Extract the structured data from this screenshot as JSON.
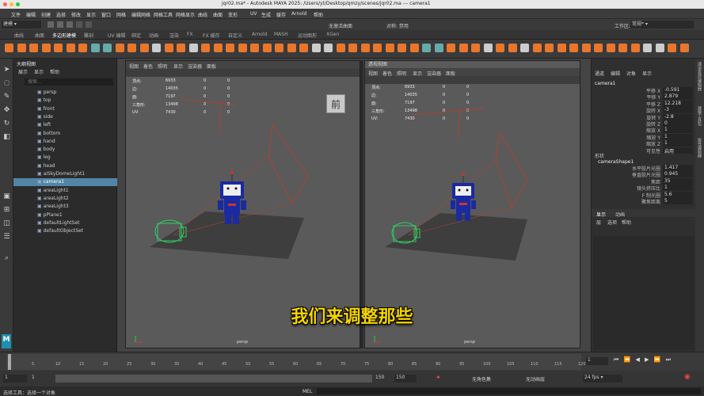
{
  "window": {
    "title": "jqr02.ma* - Autodesk MAYA 2025: /Users/yt/Desktop/qmzy/scenes/jqr02.ma  ---  camera1"
  },
  "menubar": {
    "items": [
      "文件",
      "编辑",
      "创建",
      "选择",
      "修改",
      "显示",
      "窗口",
      "网格",
      "编辑网格",
      "网格工具",
      "网格显示",
      "曲线",
      "曲面",
      "变形",
      "UV",
      "生成",
      "缓存",
      "Arnold",
      "帮助"
    ]
  },
  "statusline": {
    "mode": "建模",
    "symmetry": "对称: 禁用",
    "live": "无激活曲面",
    "workspace_label": "工作区:",
    "workspace": "常规*"
  },
  "shelf_tabs": [
    "曲线",
    "曲面",
    "多边形建模",
    "雕刻",
    "UV 编辑",
    "绑定",
    "动画",
    "渲染",
    "FX",
    "FX 缓存",
    "自定义",
    "Arnold",
    "MASH",
    "运动图形",
    "XGen"
  ],
  "shelf_active": "多边形建模",
  "outliner": {
    "title": "大纲视图",
    "menus": [
      "展示",
      "显示",
      "帮助"
    ],
    "search_placeholder": "搜索...",
    "items": [
      "persp",
      "top",
      "front",
      "side",
      "left",
      "bottom",
      "hand",
      "body",
      "leg",
      "head",
      "aiSkyDomeLight1",
      "camera1",
      "areaLight1",
      "areaLight2",
      "areaLight3",
      "pPlane1",
      "defaultLightSet",
      "defaultObjectSet"
    ],
    "selected": "camera1"
  },
  "viewport_left": {
    "menus": [
      "视图",
      "着色",
      "照明",
      "显示",
      "渲染器",
      "面板"
    ],
    "hud": [
      [
        "顶点:",
        "6933",
        "0",
        "0"
      ],
      [
        "边:",
        "14035",
        "0",
        "0"
      ],
      [
        "面:",
        "7197",
        "0",
        "0"
      ],
      [
        "三角形:",
        "13498",
        "0",
        "0"
      ],
      [
        "UV:",
        "7430",
        "0",
        "0"
      ]
    ],
    "camera_label": "persp",
    "viewcube": "前"
  },
  "viewport_right": {
    "title": "透视视图",
    "menus": [
      "视图",
      "着色",
      "照明",
      "显示",
      "渲染器",
      "面板"
    ],
    "hud": [
      [
        "顶点:",
        "6933",
        "0",
        "0"
      ],
      [
        "边:",
        "14035",
        "0",
        "0"
      ],
      [
        "面:",
        "7197",
        "0",
        "0"
      ],
      [
        "三角形:",
        "13498",
        "0",
        "0"
      ],
      [
        "UV:",
        "7430",
        "0",
        "0"
      ]
    ],
    "camera_label": "persp"
  },
  "channel_box": {
    "menus": [
      "通道",
      "编辑",
      "对象",
      "显示"
    ],
    "object": "camera1",
    "channels": [
      [
        "平移 X",
        "-0.591"
      ],
      [
        "平移 Y",
        "2.879"
      ],
      [
        "平移 Z",
        "12.218"
      ],
      [
        "旋转 X",
        "-3"
      ],
      [
        "旋转 Y",
        "-2.8"
      ],
      [
        "旋转 Z",
        "0"
      ],
      [
        "缩放 X",
        "1"
      ],
      [
        "缩放 Y",
        "1"
      ],
      [
        "缩放 Z",
        "1"
      ],
      [
        "可见性",
        "启用"
      ]
    ],
    "shapes_label": "形状",
    "shape": "cameraShape1",
    "shape_channels": [
      [
        "水平胶片光圈",
        "1.417"
      ],
      [
        "垂直胶片光圈",
        "0.945"
      ],
      [
        "焦距",
        "35"
      ],
      [
        "镜头挤压比",
        "1"
      ],
      [
        "F 制光圈",
        "5.6"
      ],
      [
        "聚焦距离",
        "5"
      ]
    ],
    "layer_tabs": [
      "显示",
      "动画"
    ],
    "layer_menus": [
      "层",
      "选项",
      "帮助"
    ]
  },
  "side_tabs": [
    "通道盒/层编辑器",
    "建模工具包",
    "属性编辑器"
  ],
  "timeline": {
    "ticks": [
      "1",
      "5",
      "10",
      "15",
      "20",
      "25",
      "30",
      "35",
      "40",
      "45",
      "50",
      "55",
      "60",
      "65",
      "70",
      "75",
      "80",
      "85",
      "90",
      "95",
      "100",
      "105",
      "110",
      "115",
      "120"
    ],
    "current": "1"
  },
  "range": {
    "start": "1",
    "start2": "1",
    "end_inner": "150",
    "end": "150",
    "char_set": "无角色集",
    "anim_layer": "无动画层",
    "fps": "24 fps"
  },
  "help_line": {
    "text": "选择工具：选择一个对象",
    "mel": "MEL"
  },
  "subtitle": "我们来调整那些",
  "logo": "M",
  "colors": {
    "accent": "#5285a6",
    "subtitle": "#f5d400"
  }
}
